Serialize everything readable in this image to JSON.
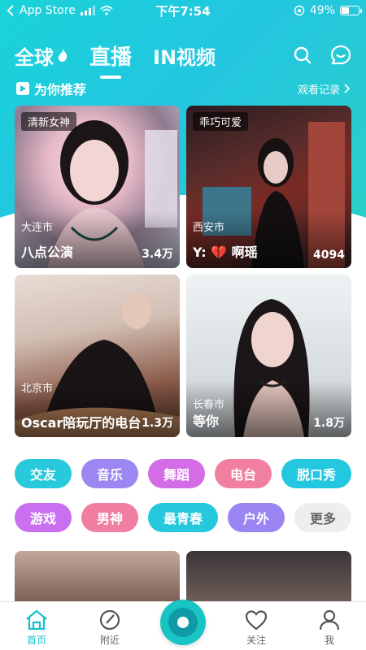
{
  "status_bar": {
    "back_app": "App Store",
    "time": "下午7:54",
    "battery": "49%",
    "battery_level": 0.49
  },
  "top_tabs": [
    {
      "label": "全球",
      "active": false
    },
    {
      "label": "直播",
      "active": true
    },
    {
      "label": "IN视频",
      "active": false
    }
  ],
  "section": {
    "title": "为你推荐",
    "history_label": "观看记录"
  },
  "cards": [
    {
      "tag": "清新女神",
      "city": "大连市",
      "name": "八点公演",
      "count": "3.4万"
    },
    {
      "tag": "乖巧可爱",
      "city": "西安市",
      "name": "Y: 💔 啊瑶",
      "count": "4094"
    },
    {
      "tag": "",
      "city": "北京市",
      "name": "Oscar陪玩厅的电台",
      "count": "1.3万"
    },
    {
      "tag": "",
      "city": "长春市",
      "name": "等你",
      "count": "1.8万"
    }
  ],
  "categories_row1": [
    {
      "label": "交友",
      "color": "#27c9db"
    },
    {
      "label": "音乐",
      "color": "#9b86f2"
    },
    {
      "label": "舞蹈",
      "color": "#d36ce6"
    },
    {
      "label": "电台",
      "color": "#f07fa0"
    },
    {
      "label": "脱口秀",
      "color": "#23c7e0"
    }
  ],
  "categories_row2": [
    {
      "label": "游戏",
      "color": "#c96ff0"
    },
    {
      "label": "男神",
      "color": "#f07ea0"
    },
    {
      "label": "最青春",
      "color": "#25c8dc"
    },
    {
      "label": "户外",
      "color": "#9a85f2"
    },
    {
      "label": "更多",
      "color": "#eeeeee"
    }
  ],
  "tab_bar": [
    {
      "label": "首页",
      "active": true
    },
    {
      "label": "附近",
      "active": false
    },
    {
      "label": "",
      "active": false
    },
    {
      "label": "关注",
      "active": false
    },
    {
      "label": "我",
      "active": false
    }
  ],
  "colors": {
    "accent": "#14c2cc",
    "header_gradient_start": "#19d3d9",
    "header_gradient_end": "#2ad0c6"
  }
}
